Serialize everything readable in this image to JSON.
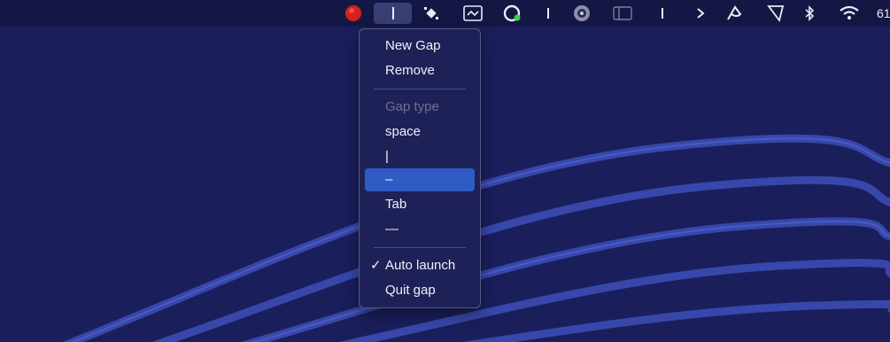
{
  "menubar": {
    "icons": [
      "record-icon",
      "gap-icon",
      "app-icon",
      "screenshot-icon",
      "sync-icon",
      "divider-icon",
      "globe-icon",
      "sidebar-icon",
      "divider-icon",
      "chevron-right-icon",
      "arc-icon",
      "flag-icon",
      "bluetooth-icon",
      "wifi-icon"
    ],
    "clock": "61"
  },
  "menu": {
    "new_gap": "New Gap",
    "remove": "Remove",
    "gap_type_header": "Gap type",
    "options": [
      "space",
      "|",
      "–",
      "Tab",
      "—"
    ],
    "selected_option": "–",
    "auto_launch_check": "✓",
    "auto_launch": "Auto launch",
    "quit": "Quit gap"
  },
  "colors": {
    "wallpaper": "#1a1f5c",
    "menubar": "#141744",
    "menu_bg": "#1e2157",
    "highlight": "#2e5cc4"
  }
}
